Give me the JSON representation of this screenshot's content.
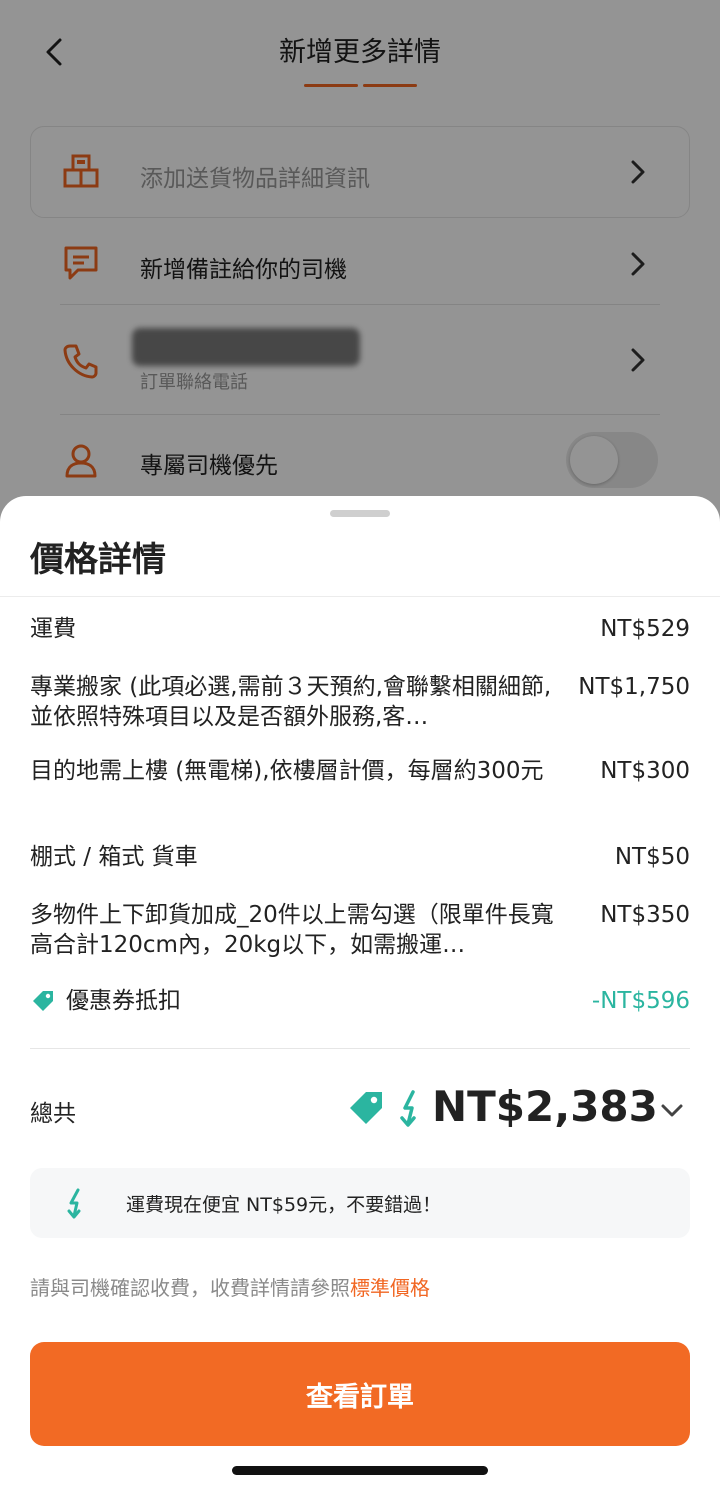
{
  "background_page": {
    "title": "新增更多詳情",
    "rows": [
      {
        "label": "添加送貨物品詳細資訊",
        "icon": "boxes-icon"
      },
      {
        "label": "新增備註給你的司機",
        "icon": "message-icon"
      },
      {
        "label": "訂單聯絡電話",
        "icon": "phone-icon"
      },
      {
        "label": "專屬司機優先",
        "icon": "driver-icon",
        "toggle": false
      }
    ]
  },
  "sheet": {
    "title": "價格詳情",
    "items": [
      {
        "label": "運費",
        "value": "NT$529"
      },
      {
        "label": "專業搬家 (此項必選,需前３天預約,會聯繫相關細節,並依照特殊項目以及是否額外服務,客…",
        "value": "NT$1,750"
      },
      {
        "label": "目的地需上樓 (無電梯),依樓層計價，每層約300元",
        "value": "NT$300"
      },
      {
        "label": "棚式 / 箱式 貨車",
        "value": "NT$50"
      },
      {
        "label": "多物件上下卸貨加成_20件以上需勾選（限單件長寬高合計120cm內，20kg以下，如需搬運…",
        "value": "NT$350"
      }
    ],
    "coupon": {
      "label": "優惠券抵扣",
      "value": "-NT$596"
    },
    "total": {
      "label": "總共",
      "value": "NT$2,383"
    },
    "promo_text": "運費現在便宜 NT$59元，不要錯過！",
    "note": {
      "text": "請與司機確認收費，收費詳情請參照",
      "link": "標準價格"
    },
    "cta": "查看訂單"
  },
  "colors": {
    "accent": "#f26a24",
    "discount": "#2bb5a0"
  }
}
